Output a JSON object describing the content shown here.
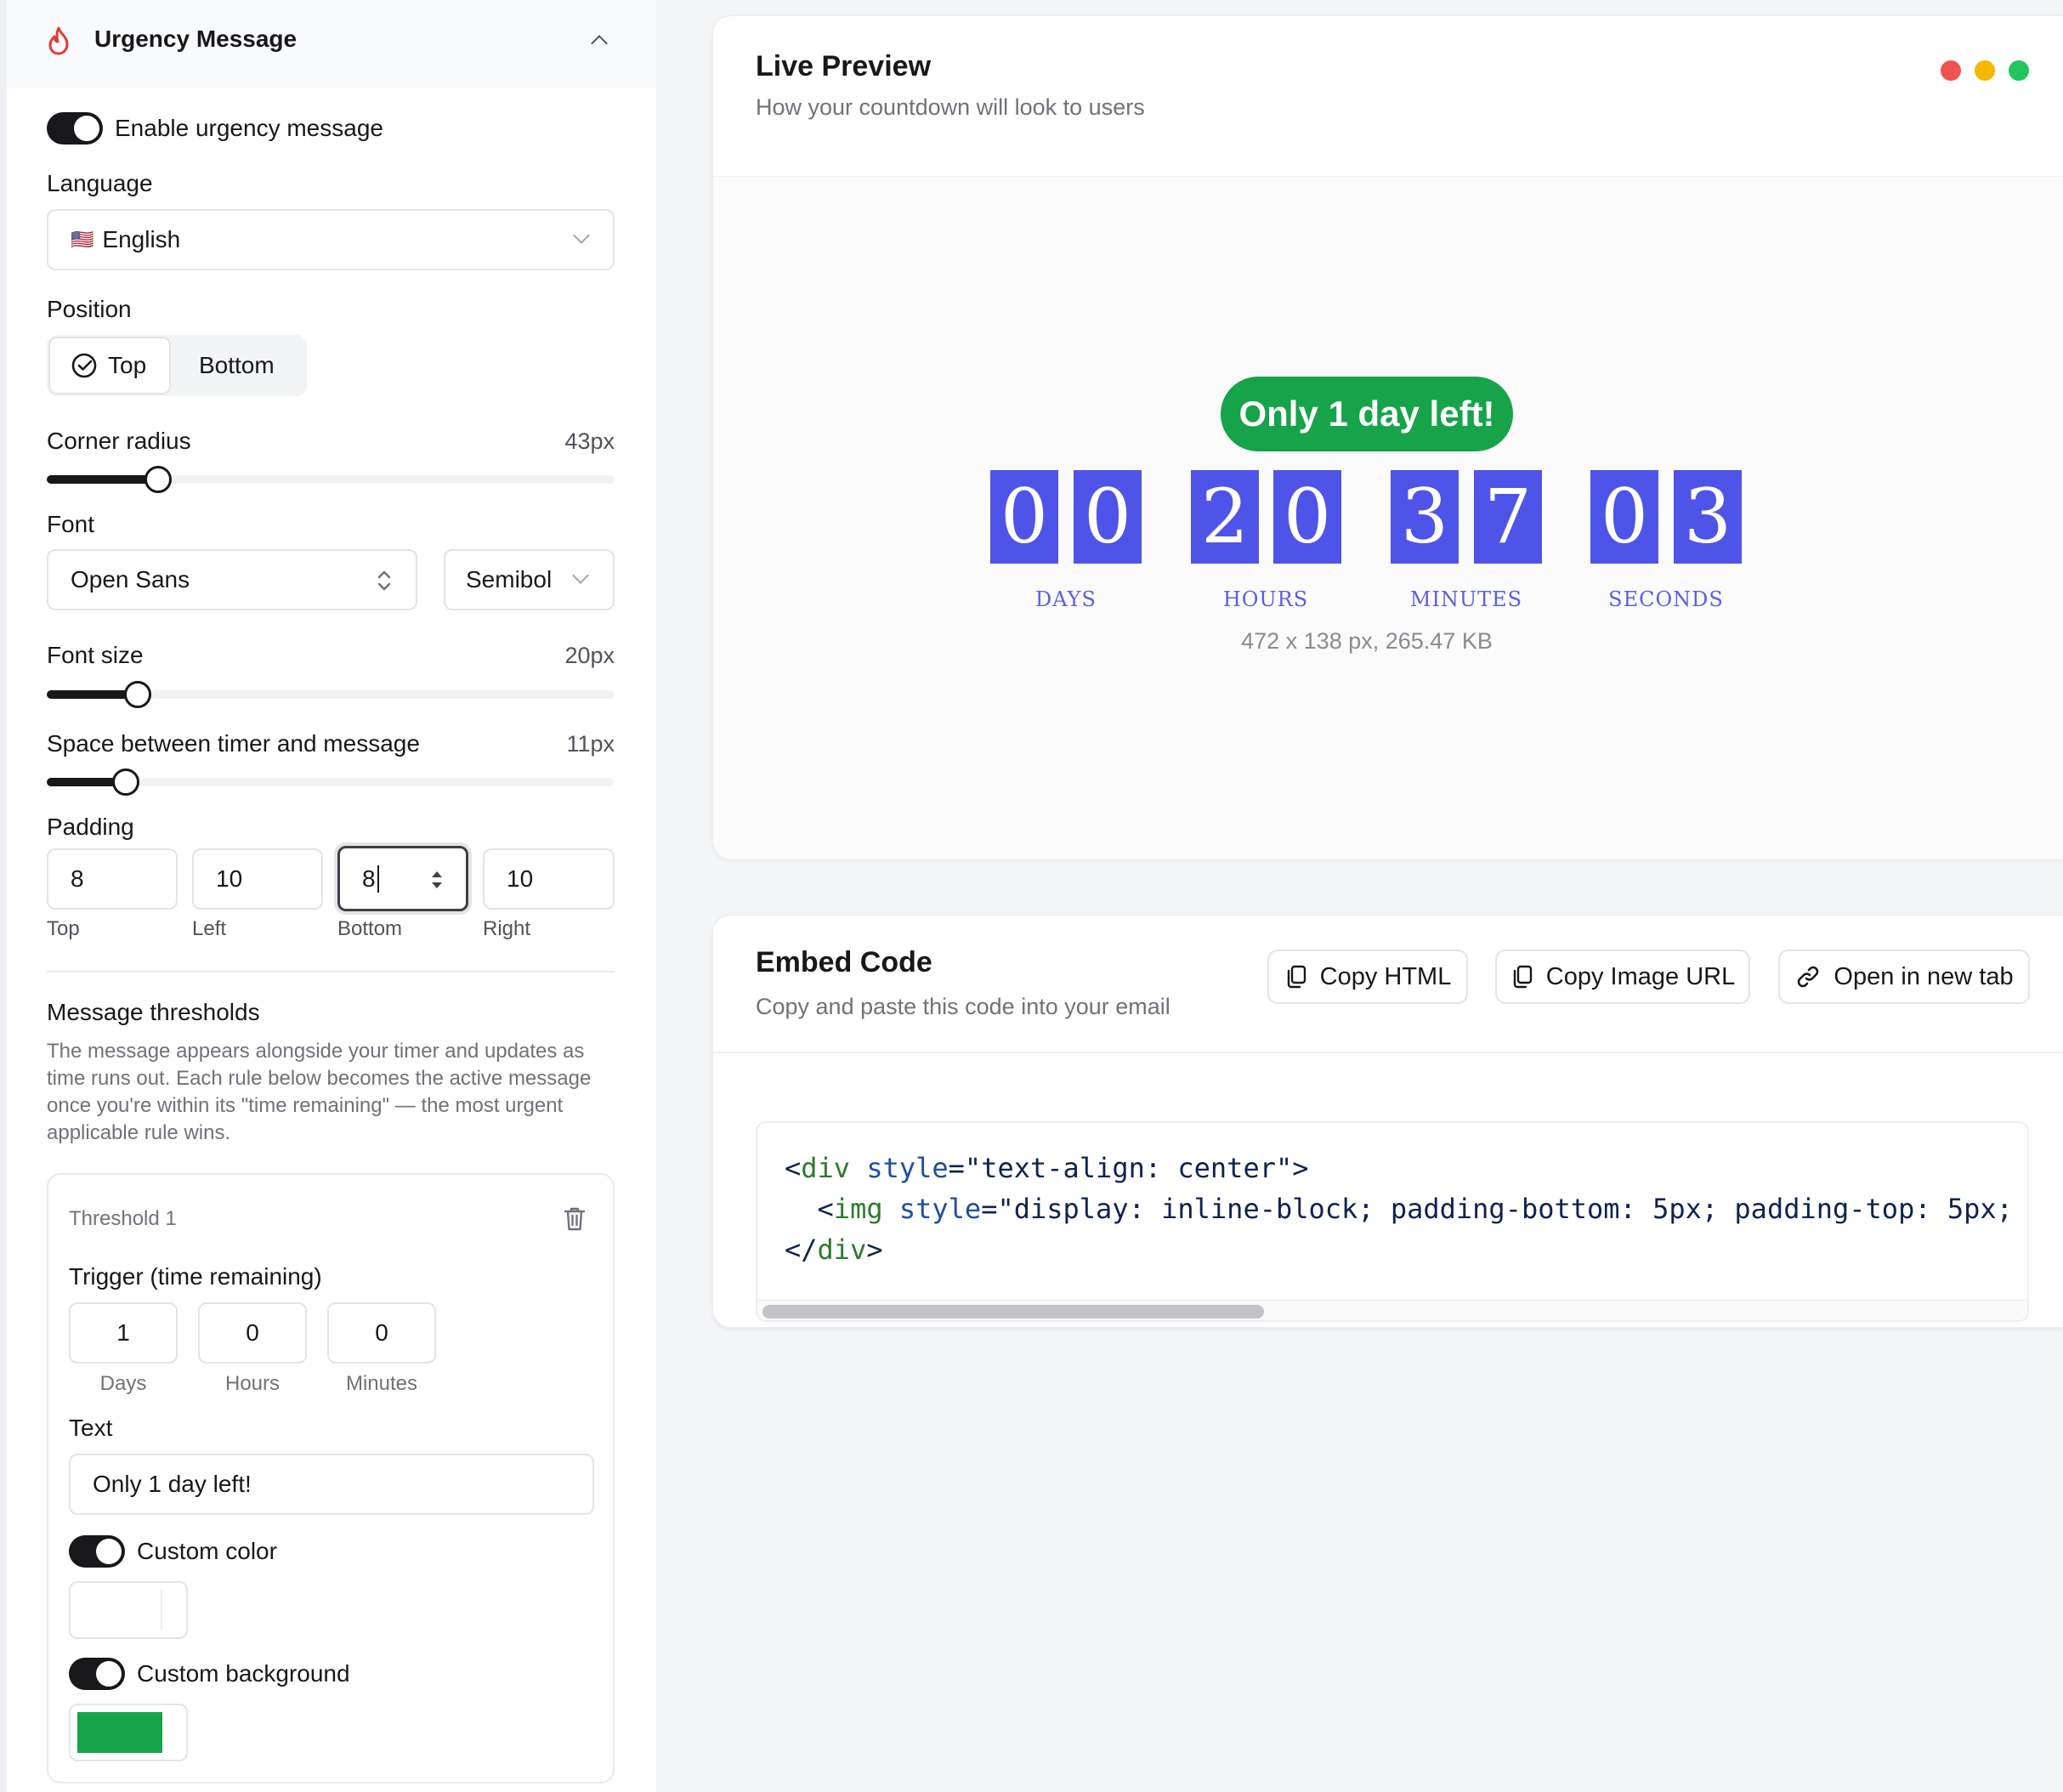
{
  "left": {
    "header_title": "Urgency Message",
    "enable_label": "Enable urgency message",
    "language_label": "Language",
    "language_value": "English",
    "language_flag": "🇺🇸",
    "position_label": "Position",
    "position_options": [
      "Top",
      "Bottom"
    ],
    "position_selected": "Top",
    "corner_radius_label": "Corner radius",
    "corner_radius_value": "43px",
    "font_label": "Font",
    "font_family_value": "Open Sans",
    "font_weight_value": "Semibol",
    "font_size_label": "Font size",
    "font_size_value": "20px",
    "spacing_label": "Space between timer and message",
    "spacing_value": "11px",
    "padding_label": "Padding",
    "padding": [
      {
        "value": "8",
        "caption": "Top"
      },
      {
        "value": "10",
        "caption": "Left"
      },
      {
        "value": "8",
        "caption": "Bottom"
      },
      {
        "value": "10",
        "caption": "Right"
      }
    ],
    "thresholds_title": "Message thresholds",
    "thresholds_desc_1": "The message appears alongside your timer and updates as",
    "thresholds_desc_2": "time runs out. Each rule below becomes the active message",
    "thresholds_desc_3": "once you're within its \"time remaining\" — the most urgent",
    "thresholds_desc_4": "applicable rule wins.",
    "threshold": {
      "title": "Threshold 1",
      "trigger_label": "Trigger (time remaining)",
      "trigger": [
        {
          "value": "1",
          "caption": "Days"
        },
        {
          "value": "0",
          "caption": "Hours"
        },
        {
          "value": "0",
          "caption": "Minutes"
        }
      ],
      "text_label": "Text",
      "text_value": "Only 1 day left!",
      "custom_color_label": "Custom color",
      "custom_color_value": "#ffffff",
      "custom_bg_label": "Custom background",
      "custom_bg_value": "#16a34a"
    }
  },
  "preview": {
    "title": "Live Preview",
    "subtitle": "How your countdown will look to users",
    "window_dots": [
      "#ef5350",
      "#f5b800",
      "#22c55e"
    ],
    "message": "Only 1 day left!",
    "message_bg": "#16a34a",
    "digit_color": "#4f54e8",
    "units": [
      {
        "digits": [
          "0",
          "0"
        ],
        "label": "DAYS"
      },
      {
        "digits": [
          "2",
          "0"
        ],
        "label": "HOURS"
      },
      {
        "digits": [
          "3",
          "7"
        ],
        "label": "MINUTES"
      },
      {
        "digits": [
          "0",
          "3"
        ],
        "label": "SECONDS"
      }
    ],
    "meta": "472 x 138 px, 265.47 KB"
  },
  "embed": {
    "title": "Embed Code",
    "subtitle": "Copy and paste this code into your email",
    "buttons": [
      "Copy HTML",
      "Copy Image URL",
      "Open in new tab"
    ]
  }
}
